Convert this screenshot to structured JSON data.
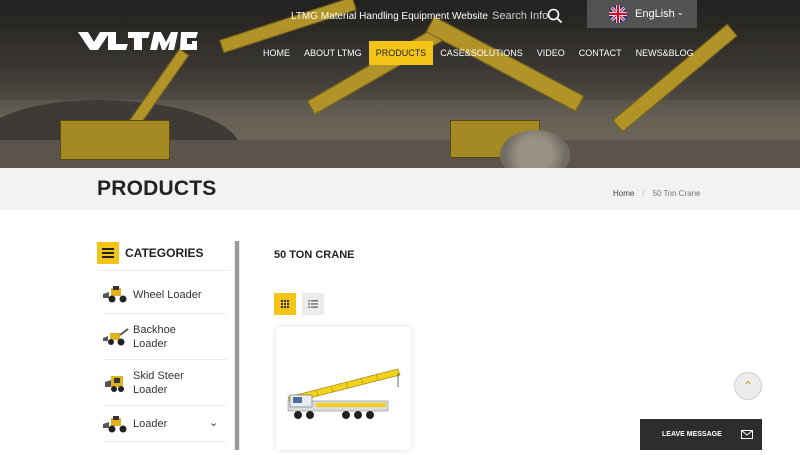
{
  "header": {
    "site_label": "LTMG Material Handling Equipment Website",
    "search_label": "Search Info",
    "language": "EngLish",
    "logo_text": "LTMG"
  },
  "nav": {
    "items": [
      {
        "label": "HOME"
      },
      {
        "label": "ABOUT LTMG"
      },
      {
        "label": "PRODUCTS"
      },
      {
        "label": "CASE&SOLUTIONS"
      },
      {
        "label": "VIDEO"
      },
      {
        "label": "CONTACT"
      },
      {
        "label": "NEWS&BLOG"
      }
    ],
    "active_index": 2
  },
  "banner": {
    "title": "PRODUCTS",
    "breadcrumb": [
      "Home",
      "50 Ton Crane"
    ]
  },
  "sidebar": {
    "title": "CATEGORIES",
    "items": [
      {
        "label": "Wheel Loader",
        "icon": "wheel-loader-thumbnail"
      },
      {
        "label": "Backhoe Loader",
        "icon": "backhoe-loader-thumbnail"
      },
      {
        "label": "Skid Steer Loader",
        "icon": "skid-steer-loader-thumbnail"
      },
      {
        "label": "Loader",
        "icon": "loader-thumbnail",
        "expandable": true
      }
    ]
  },
  "main": {
    "title": "50 TON CRANE",
    "view_modes": [
      "grid-view-icon",
      "list-view-icon"
    ],
    "active_view": "grid"
  },
  "widgets": {
    "leave_message": "LEAVE MESSAGE"
  },
  "colors": {
    "accent": "#f5c418",
    "dark_panel": "#2d2d2d",
    "banner_bg": "#f2f2f2"
  }
}
